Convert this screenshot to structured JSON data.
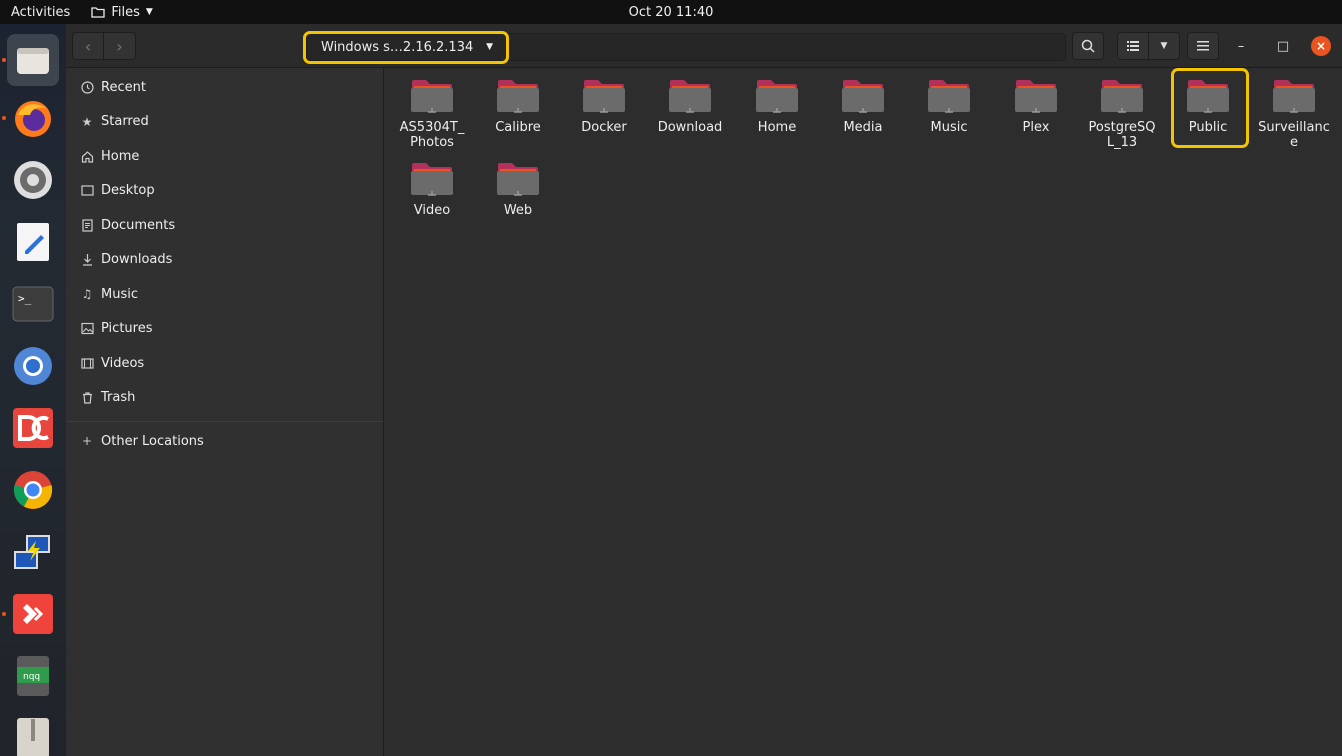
{
  "topbar": {
    "activities_label": "Activities",
    "app_menu_label": "Files",
    "clock": "Oct 20  11:40"
  },
  "dock": {
    "items": [
      {
        "name": "files-icon",
        "running": true
      },
      {
        "name": "firefox-icon",
        "running": true
      },
      {
        "name": "settings-icon",
        "running": false
      },
      {
        "name": "text-editor-icon",
        "running": false
      },
      {
        "name": "terminal-icon",
        "running": false
      },
      {
        "name": "chromium-icon",
        "running": false
      },
      {
        "name": "doublecmd-icon",
        "running": false
      },
      {
        "name": "chrome-icon",
        "running": false
      },
      {
        "name": "remote-desktop-icon",
        "running": false
      },
      {
        "name": "anydesk-icon",
        "running": true
      },
      {
        "name": "notes-icon",
        "running": false
      },
      {
        "name": "archive-icon",
        "running": false
      }
    ],
    "notes_label": "nqq"
  },
  "headerbar": {
    "path_label": "Windows s…2.16.2.134"
  },
  "sidebar": {
    "items": [
      {
        "label": "Recent",
        "icon": "clock-icon"
      },
      {
        "label": "Starred",
        "icon": "star-icon"
      },
      {
        "label": "Home",
        "icon": "home-icon"
      },
      {
        "label": "Desktop",
        "icon": "desktop-icon"
      },
      {
        "label": "Documents",
        "icon": "document-icon"
      },
      {
        "label": "Downloads",
        "icon": "download-icon"
      },
      {
        "label": "Music",
        "icon": "music-icon"
      },
      {
        "label": "Pictures",
        "icon": "picture-icon"
      },
      {
        "label": "Videos",
        "icon": "video-icon"
      },
      {
        "label": "Trash",
        "icon": "trash-icon"
      }
    ],
    "other_locations": "Other Locations"
  },
  "folders": [
    {
      "label": "AS5304T_Photos"
    },
    {
      "label": "Calibre"
    },
    {
      "label": "Docker"
    },
    {
      "label": "Download"
    },
    {
      "label": "Home"
    },
    {
      "label": "Media"
    },
    {
      "label": "Music"
    },
    {
      "label": "Plex"
    },
    {
      "label": "PostgreSQL_13"
    },
    {
      "label": "Public"
    },
    {
      "label": "Surveillance"
    },
    {
      "label": "Video"
    },
    {
      "label": "Web"
    }
  ],
  "colors": {
    "accent": "#e95420",
    "highlight": "#f5c400",
    "folder_tab": "#b3305a",
    "folder_body": "#6b6b6b"
  }
}
